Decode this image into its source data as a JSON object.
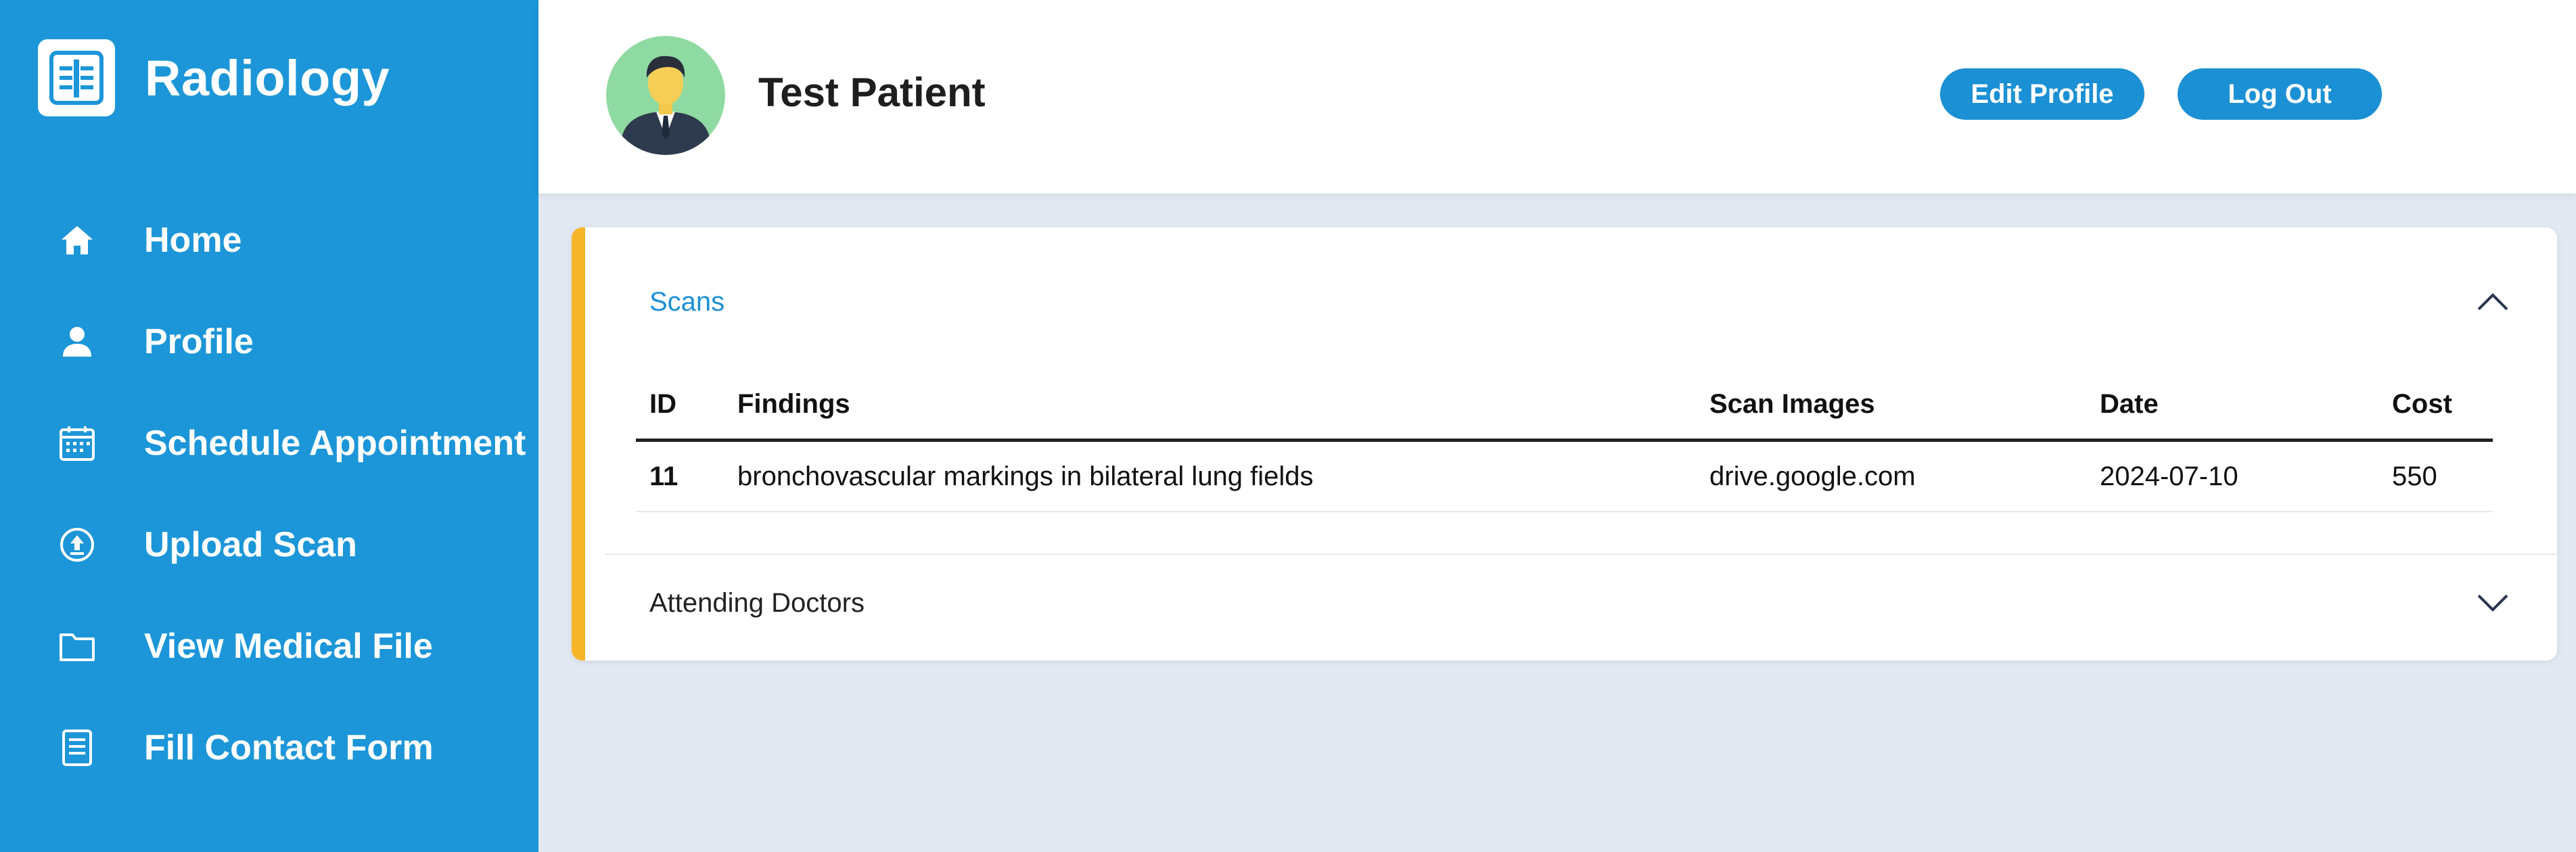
{
  "app": {
    "title": "Radiology",
    "logo_icon": "xray-icon"
  },
  "colors": {
    "sidebar": "#1c96d8",
    "accent_button": "#1c90d4",
    "card_accent": "#f6b428",
    "page_background": "#e2e9f2",
    "active_section_title": "#1c90d4"
  },
  "sidebar": {
    "items": [
      {
        "label": "Home",
        "icon": "home-icon"
      },
      {
        "label": "Profile",
        "icon": "user-icon"
      },
      {
        "label": "Schedule Appointment",
        "icon": "calendar-icon"
      },
      {
        "label": "Upload Scan",
        "icon": "upload-icon"
      },
      {
        "label": "View Medical File",
        "icon": "folder-icon"
      },
      {
        "label": "Fill Contact Form",
        "icon": "form-icon"
      }
    ]
  },
  "header": {
    "patient_name": "Test Patient",
    "avatar_icon": "avatar-icon",
    "edit_profile_label": "Edit Profile",
    "logout_label": "Log Out"
  },
  "scans": {
    "title": "Scans",
    "expanded": true,
    "toggle_icon": "chevron-up-icon",
    "columns": [
      "ID",
      "Findings",
      "Scan Images",
      "Date",
      "Cost"
    ],
    "rows": [
      [
        "11",
        "bronchovascular markings in bilateral lung fields",
        "drive.google.com",
        "2024-07-10",
        "550"
      ]
    ]
  },
  "doctors": {
    "title": "Attending Doctors",
    "expanded": false,
    "toggle_icon": "chevron-down-icon"
  }
}
